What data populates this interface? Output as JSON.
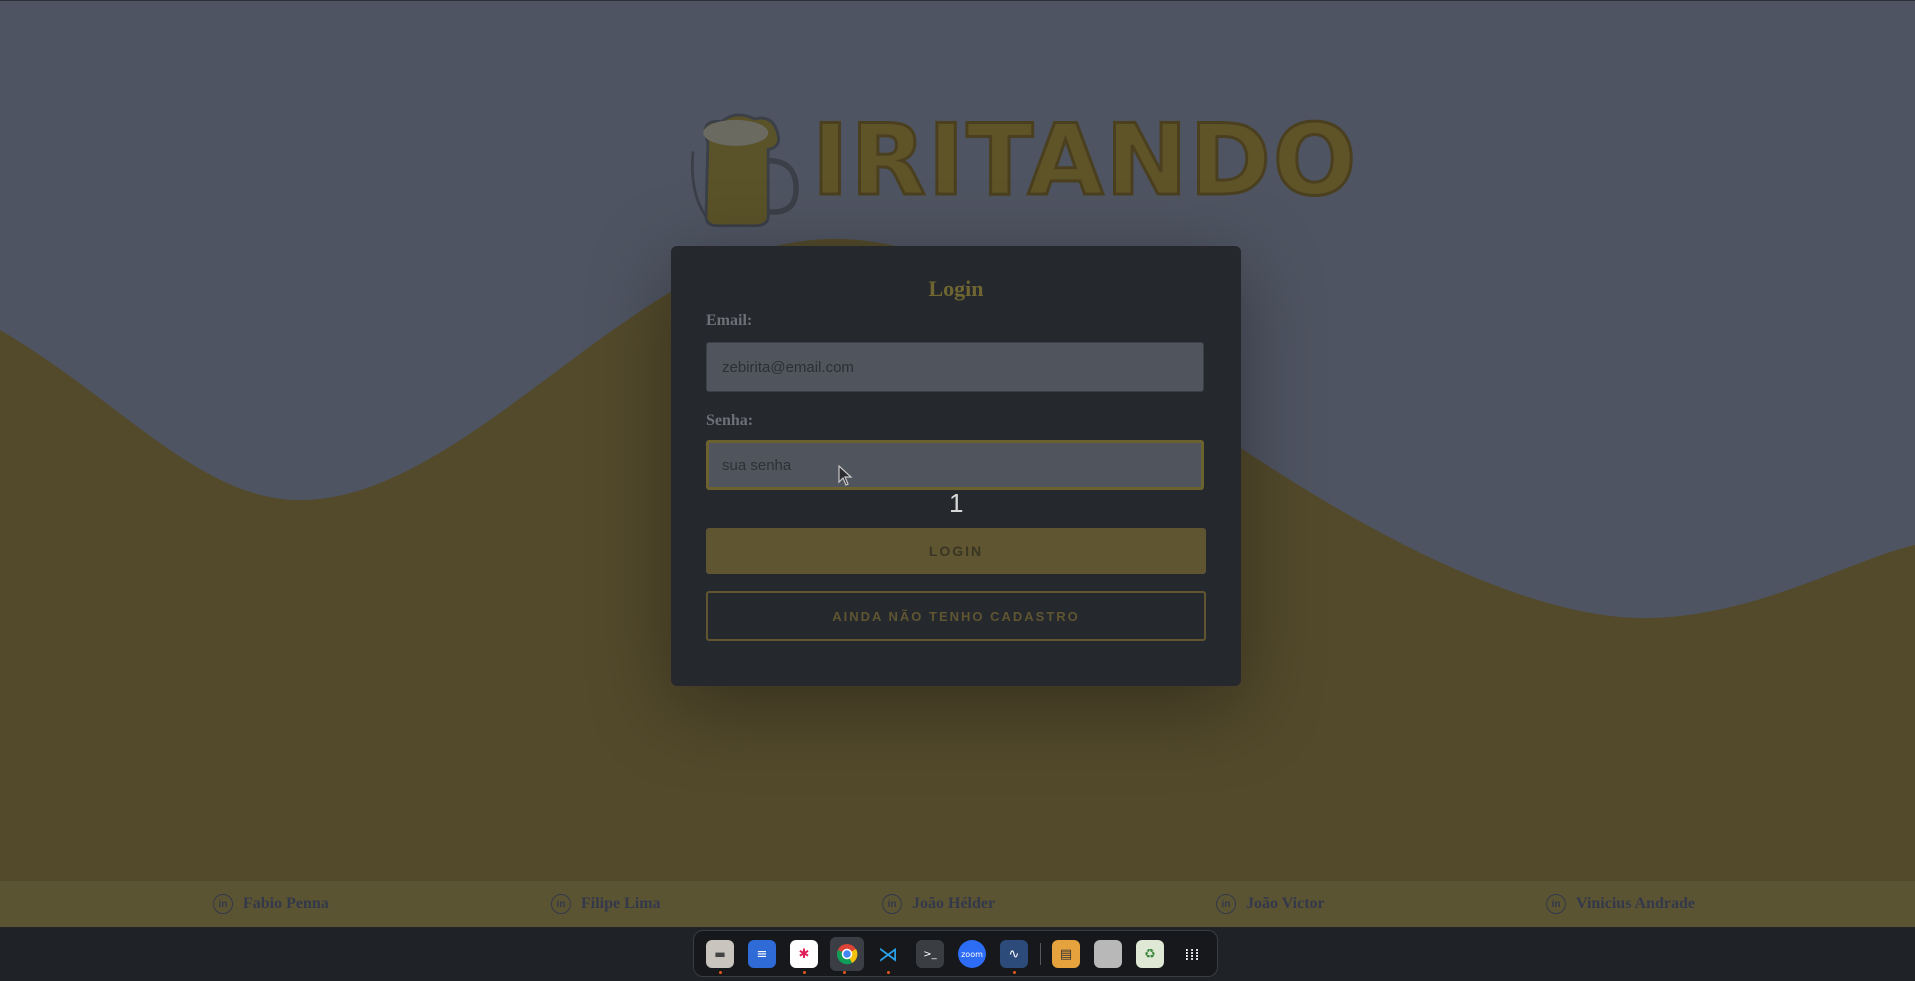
{
  "brand": {
    "logo_text": "IRITANDO"
  },
  "login": {
    "title": "Login",
    "email_label": "Email:",
    "email_value": "zebirita@email.com",
    "password_label": "Senha:",
    "password_placeholder": "sua senha",
    "counter": "1",
    "login_button": "LOGIN",
    "register_button": "AINDA NÃO TENHO CADASTRO"
  },
  "footer": {
    "credits": [
      {
        "name": "Fabio Penna",
        "icon": "linkedin-icon"
      },
      {
        "name": "Filipe Lima",
        "icon": "linkedin-icon"
      },
      {
        "name": "João Hélder",
        "icon": "linkedin-icon"
      },
      {
        "name": "João Victor",
        "icon": "linkedin-icon"
      },
      {
        "name": "Vinicius Andrade",
        "icon": "linkedin-icon"
      }
    ]
  },
  "taskbar": {
    "apps": [
      "files-icon",
      "text-editor-icon",
      "slack-icon",
      "chrome-icon",
      "vscode-icon",
      "terminal-icon",
      "zoom-icon",
      "database-icon",
      "clapper-icon",
      "document-icon",
      "trash-icon",
      "apps-grid-icon"
    ]
  },
  "colors": {
    "accent": "#6e6530",
    "card": "#25292e",
    "background": "#4f5462",
    "wave": "#534a2c"
  }
}
